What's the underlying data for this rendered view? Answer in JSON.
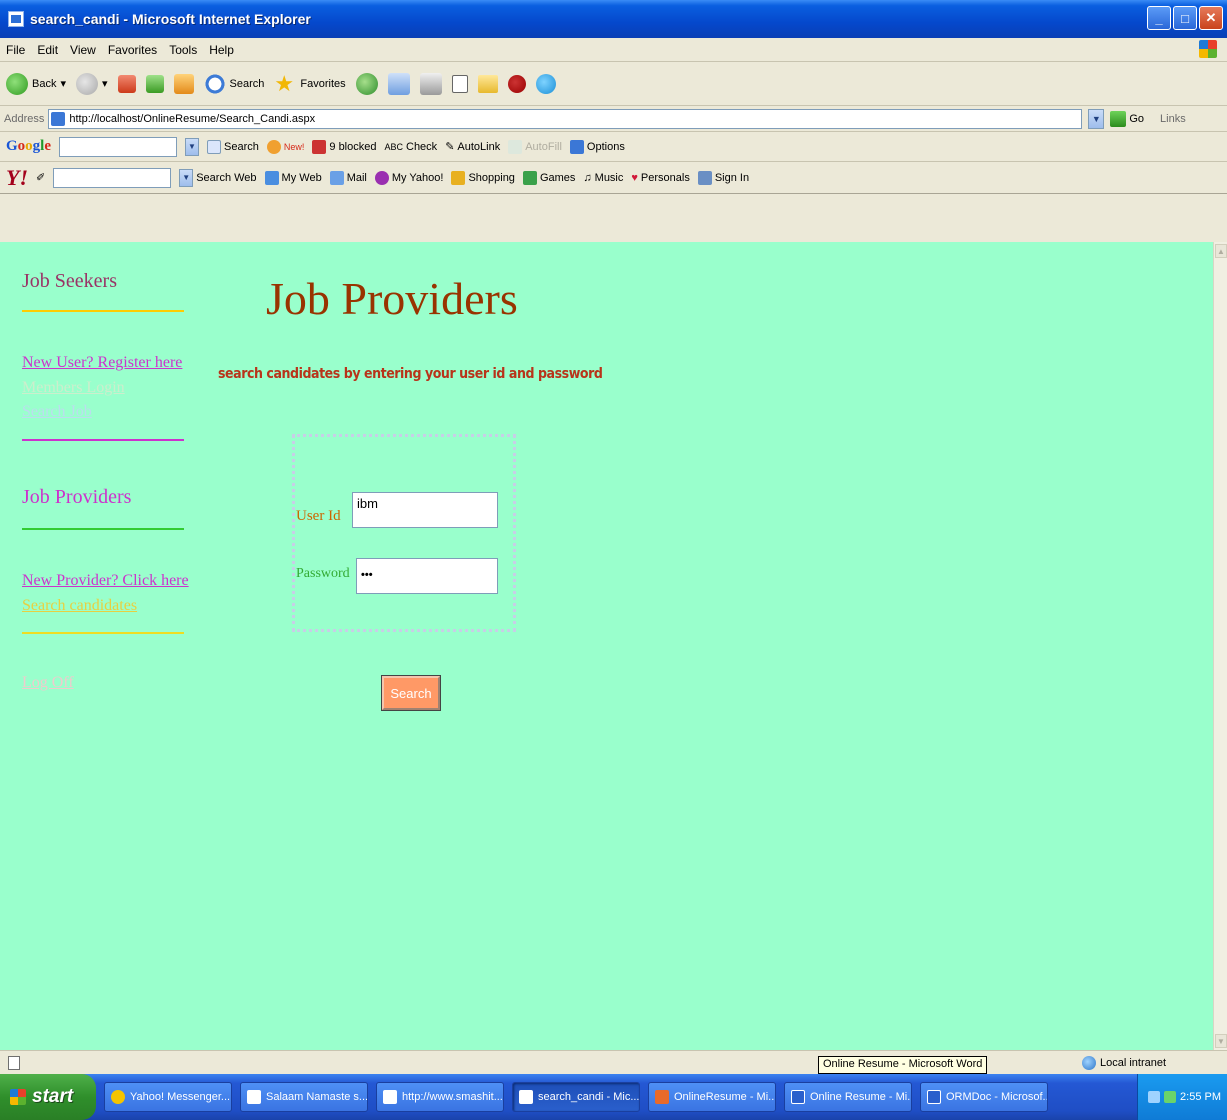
{
  "window": {
    "title": "search_candi - Microsoft Internet Explorer"
  },
  "menu": [
    "File",
    "Edit",
    "View",
    "Favorites",
    "Tools",
    "Help"
  ],
  "toolbar": {
    "back": "Back",
    "search": "Search",
    "favorites": "Favorites"
  },
  "address": {
    "label": "Address",
    "url": "http://localhost/OnlineResume/Search_Candi.aspx",
    "go": "Go",
    "links": "Links"
  },
  "google": {
    "logo": "Google",
    "search": "Search",
    "new_badge": "New!",
    "blocked": "9 blocked",
    "check": "Check",
    "autolink": "AutoLink",
    "autofill": "AutoFill",
    "options": "Options"
  },
  "yahoo": {
    "logo": "Y!",
    "search_web": "Search Web",
    "my_web": "My Web",
    "mail": "Mail",
    "my_yahoo": "My Yahoo!",
    "shopping": "Shopping",
    "games": "Games",
    "music": "Music",
    "personals": "Personals",
    "sign_in": "Sign In"
  },
  "sidebar": {
    "seekers_heading": "Job Seekers",
    "new_user": "New User? Register here",
    "member_login": "Members Login",
    "search_job": "Search Job",
    "providers_heading": "Job Providers",
    "new_provider": "New Provider? Click here",
    "search_candidates": "Search candidates",
    "log_off": "Log Off"
  },
  "main": {
    "title": "Job Providers",
    "subtitle": "search candidates by entering your user id and password",
    "userid_label": "User Id",
    "userid_value": "ibm",
    "password_label": "Password",
    "password_value": "•••",
    "search_button": "Search"
  },
  "status": {
    "zone": "Local intranet",
    "tooltip": "Online Resume - Microsoft Word"
  },
  "taskbar": {
    "start": "start",
    "tasks": [
      "Yahoo! Messenger...",
      "Salaam Namaste s...",
      "http://www.smashit...",
      "search_candi - Mic...",
      "OnlineResume - Mi...",
      "Online Resume - Mi...",
      "ORMDoc - Microsof..."
    ],
    "clock": "2:55 PM"
  },
  "colors": {
    "page_bg": "#99ffcc",
    "title_color": "#993300",
    "subtitle_color": "#b8341a",
    "seekers_heading": "#993366",
    "providers_heading": "#cc33cc",
    "button_bg": "#ff9966"
  }
}
